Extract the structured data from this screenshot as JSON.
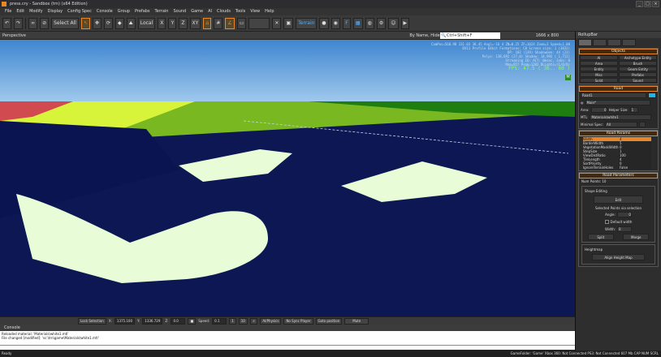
{
  "window": {
    "title": "press.cry - Sandbox (trn) (x64 Edition)",
    "buttons": [
      "_",
      "□",
      "×"
    ]
  },
  "menu": [
    "File",
    "Edit",
    "Modify",
    "Display",
    "Config Spec",
    "Console",
    "Group",
    "Prefabs",
    "Terrain",
    "Sound",
    "Game",
    "AI",
    "Clouds",
    "Tools",
    "View",
    "Help"
  ],
  "toolbar": {
    "select_all": "Select All",
    "coord_space": "Local",
    "axis_x": "X",
    "axis_y": "Y",
    "axis_z": "Z",
    "axis_xy": "XY",
    "terrain": "Terrain"
  },
  "viewport": {
    "title": "Perspective",
    "filter": "By Name, Hide Filtered, AND",
    "search_placeholder": "Ctrl+Shift+F",
    "resolution": "1666 x 800",
    "fps": "FPS: 47.5 ( 36.. 60 )",
    "badge": "M",
    "stats": [
      "CamPos=560.98 331.03 38.45 Angl=-16   4 ZN=0.25 ZF=1024 Zoom=1 Speed=1.00",
      "DX11 Profile 64bit Formations: C8 Screen size: 1 (3832)",
      "DP:  102 (139) ShadowGen:  44 (23)",
      "Polys: 138,692 (27,0)  Shadow: 14,992 ( 1,712)",
      "Streaming IO: ACT: 0msec, Jobs: 0",
      "Mem=957 Peak=1202 DLights=(1/0/0)"
    ]
  },
  "bottombar": {
    "lock_selection": "Lock Selection",
    "x_label": "X:",
    "x_value": "1375.100",
    "y_label": "Y:",
    "y_value": "1336.729",
    "z_label": "Z:",
    "z_value": "0.0",
    "speed_label": "Speed:",
    "speed_value": "0.1",
    "speed_1": "1",
    "speed_10": "10",
    "ai_physics": "AI/Physics",
    "no_sync": "No Sync Player",
    "goto": "Goto position",
    "mute": "Mute"
  },
  "console": {
    "title": "Console",
    "lines": [
      "Reloaded material: 'Materials\\white1.mtl'",
      "File changed [modified]: 'sc:\\trn\\game\\Materials\\white1.mtl'"
    ]
  },
  "status": {
    "left": "Ready",
    "right": "GameFolder: 'Game'   Xbox 360: Not Connected   PS3: Not Connected    607 Mb   CAP   NUM   SCRL"
  },
  "rollupbar": {
    "title": "RollupBar",
    "objects": {
      "header": "Objects",
      "buttons": [
        "AI",
        "Archetype Entity",
        "Area",
        "Brush",
        "Entity",
        "Geom Entity",
        "Misc",
        "Prefabs",
        "Solid",
        "Sound"
      ]
    },
    "road": {
      "header": "Road",
      "name": "Road1",
      "color": "#19b8e8",
      "material": "Main*",
      "area_label": "Area:",
      "area_value": "0",
      "helper_label": "Helper Size:",
      "helper_value": "1",
      "mtl_label": "MTL:",
      "mtl_value": "Materials\\white1",
      "minspec_label": "Minimal Spec:",
      "minspec_value": "All"
    },
    "params": {
      "header": "Road Params",
      "rows": [
        {
          "k": "Width",
          "v": "4"
        },
        {
          "k": "BorderWidth",
          "v": "5"
        },
        {
          "k": "VegetationMaskWidth",
          "v": "0"
        },
        {
          "k": "StepSize",
          "v": "1"
        },
        {
          "k": "ViewDistRatio",
          "v": "100"
        },
        {
          "k": "TileLength",
          "v": "4"
        },
        {
          "k": "SortPriority",
          "v": "0"
        },
        {
          "k": "IgnoreTerrainHoles",
          "v": "False"
        }
      ]
    },
    "parameters": {
      "header": "Road Parameters",
      "num_points": "Num Points: 10",
      "shape_editing": "Shape Editing",
      "edit": "Edit",
      "selected_label": "Selected Points via selection",
      "angle_label": "Angle:",
      "angle_value": "0",
      "default_width": "Default width",
      "width_label": "Width:",
      "width_value": "0",
      "split": "Split",
      "merge": "Merge",
      "heightmap": "Heightmap",
      "align": "Align Height Map"
    }
  }
}
